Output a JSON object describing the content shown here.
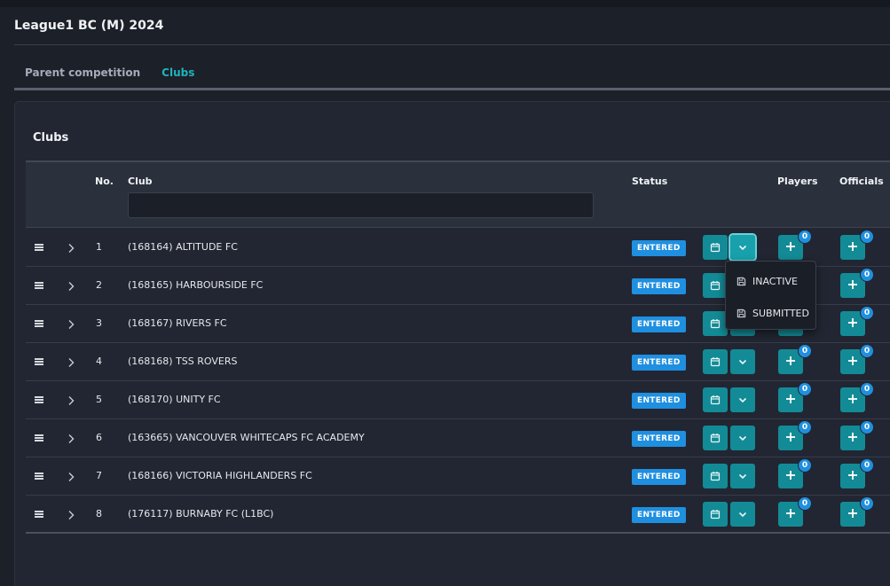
{
  "app": {
    "title": "League1 BC (M) 2024"
  },
  "tabs": [
    {
      "label": "Parent competition",
      "active": false
    },
    {
      "label": "Clubs",
      "active": true
    }
  ],
  "panel": {
    "title": "Clubs"
  },
  "table": {
    "headers": {
      "no": "No.",
      "club": "Club",
      "status": "Status",
      "players": "Players",
      "officials": "Officials"
    },
    "filter": {
      "club_value": "",
      "placeholder": ""
    },
    "rows": [
      {
        "no": "1",
        "club": "(168164) ALTITUDE FC",
        "status": "ENTERED",
        "players_count": "0",
        "officials_count": "0"
      },
      {
        "no": "2",
        "club": "(168165) HARBOURSIDE FC",
        "status": "ENTERED",
        "players_count": "0",
        "officials_count": "0"
      },
      {
        "no": "3",
        "club": "(168167) RIVERS FC",
        "status": "ENTERED",
        "players_count": "0",
        "officials_count": "0"
      },
      {
        "no": "4",
        "club": "(168168) TSS ROVERS",
        "status": "ENTERED",
        "players_count": "0",
        "officials_count": "0"
      },
      {
        "no": "5",
        "club": "(168170) UNITY FC",
        "status": "ENTERED",
        "players_count": "0",
        "officials_count": "0"
      },
      {
        "no": "6",
        "club": "(163665) VANCOUVER WHITECAPS FC ACADEMY",
        "status": "ENTERED",
        "players_count": "0",
        "officials_count": "0"
      },
      {
        "no": "7",
        "club": "(168166) VICTORIA HIGHLANDERS FC",
        "status": "ENTERED",
        "players_count": "0",
        "officials_count": "0"
      },
      {
        "no": "8",
        "club": "(176117) BURNABY FC (L1BC)",
        "status": "ENTERED",
        "players_count": "0",
        "officials_count": "0"
      }
    ]
  },
  "status_menu": {
    "open_row": "1",
    "items": [
      {
        "label": "INACTIVE",
        "icon": "save-icon"
      },
      {
        "label": "SUBMITTED",
        "icon": "save-icon"
      }
    ]
  },
  "colors": {
    "background": "#1c2029",
    "accent_teal": "#138b96",
    "active_tab": "#1fb3bd",
    "status_blue": "#1f8fe0"
  }
}
